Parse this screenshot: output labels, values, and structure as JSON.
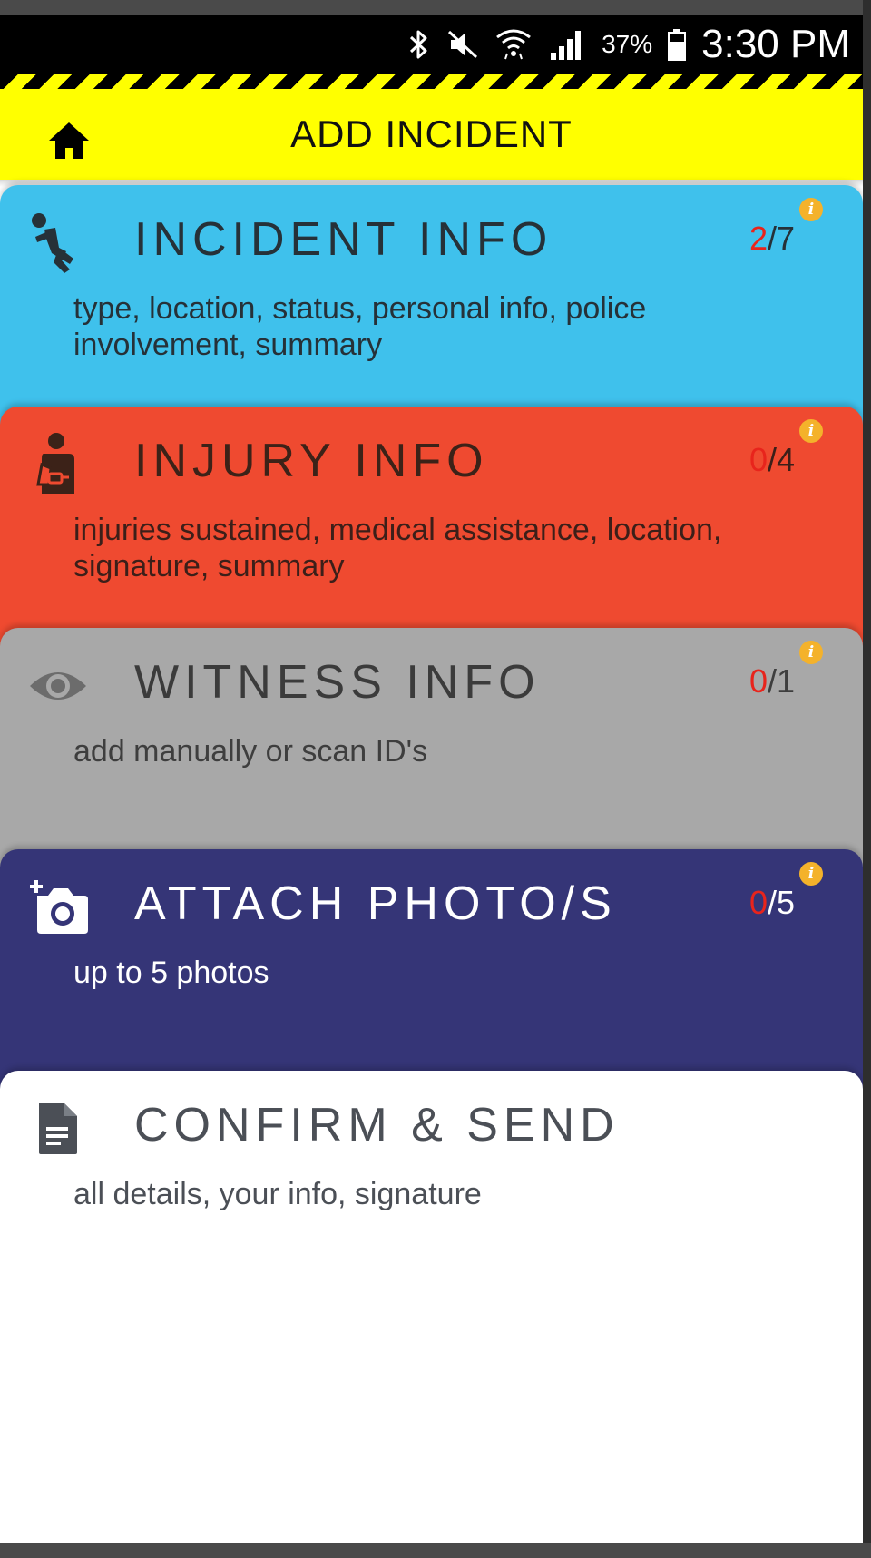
{
  "status_bar": {
    "battery_percent": "37%",
    "time": "3:30 PM",
    "icons": [
      "bluetooth-icon",
      "mute-icon",
      "wifi-icon",
      "signal-icon",
      "battery-icon"
    ]
  },
  "header": {
    "title": "ADD INCIDENT",
    "home_icon": "home-icon",
    "color": "#ffff00"
  },
  "sections": [
    {
      "title": "INCIDENT INFO",
      "description": "type, location, status, personal info, police involvement,  summary",
      "done": "2",
      "total": "/7",
      "icon": "falling-person-icon",
      "color": "#3fc1ec"
    },
    {
      "title": "INJURY INFO",
      "description": "injuries sustained,  medical assistance,  location, signature,  summary",
      "done": "0",
      "total": "/4",
      "icon": "injured-person-icon",
      "color": "#ef4a30"
    },
    {
      "title": "WITNESS INFO",
      "description": "add manually or scan ID's",
      "done": "0",
      "total": "/1",
      "icon": "eye-icon",
      "color": "#a8a8a8"
    },
    {
      "title": "ATTACH PHOTO/S",
      "description": "up to 5 photos",
      "done": "0",
      "total": "/5",
      "icon": "add-photo-icon",
      "color": "#353577"
    },
    {
      "title": "CONFIRM & SEND",
      "description": "all details,  your info,  signature",
      "icon": "document-icon",
      "color": "#ffffff"
    }
  ],
  "info_badge_glyph": "i",
  "count_done_color": "#e8241c"
}
